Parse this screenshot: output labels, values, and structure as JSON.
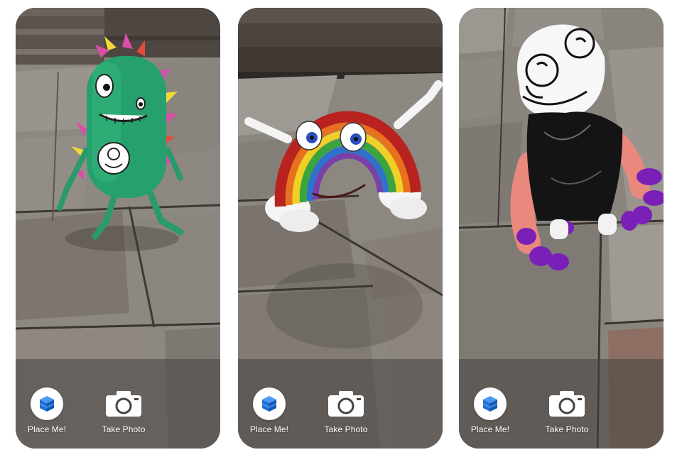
{
  "screens": [
    {
      "name": "green-monster",
      "toolbar": {
        "place_label": "Place Me!",
        "photo_label": "Take Photo"
      },
      "place_icon": "cube-icon",
      "photo_icon": "camera-icon"
    },
    {
      "name": "rainbow",
      "toolbar": {
        "place_label": "Place Me!",
        "photo_label": "Take Photo"
      },
      "place_icon": "cube-icon",
      "photo_icon": "camera-icon"
    },
    {
      "name": "drawn-face-creature",
      "toolbar": {
        "place_label": "Place Me!",
        "photo_label": "Take Photo"
      },
      "place_icon": "cube-icon",
      "photo_icon": "camera-icon"
    }
  ],
  "colors": {
    "toolbar_bg": "#46423e",
    "label_text": "#ffffff",
    "cube_blue": "#1e6fd6",
    "monster_green": "#25a06e",
    "creature_pink": "#e9897e",
    "creature_purple": "#7a1fb8"
  }
}
